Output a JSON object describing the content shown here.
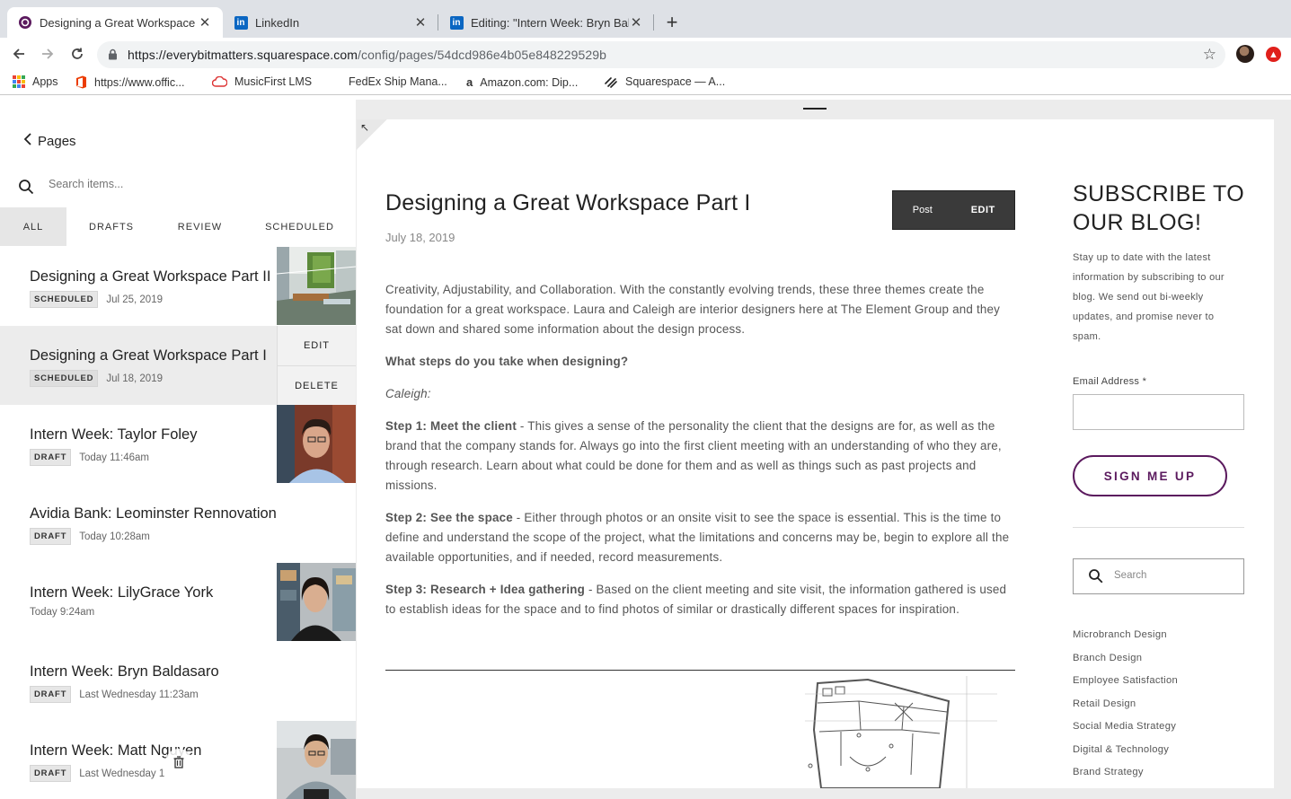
{
  "browser": {
    "tabs": [
      {
        "title": "Designing a Great Workspace P",
        "active": true
      },
      {
        "title": "LinkedIn",
        "active": false
      },
      {
        "title": "Editing: \"Intern Week: Bryn Bal",
        "active": false
      }
    ],
    "url_domain": "https://everybitmatters.squarespace.com",
    "url_path": "/config/pages/54dcd986e4b05e848229529b",
    "bookmarks": [
      "Apps",
      "https://www.offic...",
      "MusicFirst LMS",
      "FedEx Ship Mana...",
      "Amazon.com: Dip...",
      "Squarespace — A..."
    ]
  },
  "panel": {
    "back_label": "Pages",
    "search_placeholder": "Search items...",
    "filters": [
      "ALL",
      "DRAFTS",
      "REVIEW",
      "SCHEDULED"
    ],
    "items": [
      {
        "title": "Designing a Great Workspace Part II",
        "status": "SCHEDULED",
        "date": "Jul 25, 2019"
      },
      {
        "title": "Designing a Great Workspace Part I",
        "status": "SCHEDULED",
        "date": "Jul 18, 2019"
      },
      {
        "title": "Intern Week: Taylor Foley",
        "status": "DRAFT",
        "date": "Today 11:46am"
      },
      {
        "title": "Avidia Bank: Leominster Rennovation",
        "status": "DRAFT",
        "date": "Today 10:28am"
      },
      {
        "title": "Intern Week: LilyGrace York",
        "status": "",
        "date": "Today 9:24am"
      },
      {
        "title": "Intern Week: Bryn Baldasaro",
        "status": "DRAFT",
        "date": "Last Wednesday 11:23am"
      },
      {
        "title": "Intern Week: Matt Nguyen",
        "status": "DRAFT",
        "date": "Last Wednesday 1"
      }
    ],
    "actions": {
      "edit": "EDIT",
      "delete": "DELETE"
    }
  },
  "post": {
    "title": "Designing a Great Workspace Part I",
    "date": "July 18, 2019",
    "btn_post": "Post",
    "btn_edit": "EDIT",
    "intro": "Creativity, Adjustability, and Collaboration. With the constantly evolving trends, these three themes create the foundation for a great workspace. Laura and Caleigh are interior designers here at The Element Group and they sat down and shared some information about the design process.",
    "question": "What steps do you take when designing?",
    "speaker": "Caleigh:",
    "step1_head": "Step 1: Meet the client",
    "step1_body": " - This gives a sense of the personality the client that the designs are for, as well as the brand that the company stands for. Always go into the first client meeting with an understanding of who they are, through research. Learn about what could be done for them and as well as things such as past projects and missions.",
    "step2_head": "Step 2: See the space",
    "step2_body": " - Either through photos or an onsite visit to see the space is essential. This is the time to define and understand the scope of the project, what the limitations and concerns may be, begin to explore all the available opportunities, and if needed, record measurements.",
    "step3_head": "Step 3: Research + Idea gathering",
    "step3_body": " - Based on the client meeting and site visit, the information gathered is used to establish ideas for the space and to find photos of similar or drastically different spaces for inspiration."
  },
  "sidebar": {
    "subscribe_title": "SUBSCRIBE TO OUR BLOG!",
    "subscribe_desc": "Stay up to date with the latest information by subscribing to our blog. We send out bi-weekly updates, and promise never to spam.",
    "email_label": "Email Address *",
    "signup_label": "SIGN ME UP",
    "search_placeholder": "Search",
    "categories": [
      "Microbranch Design",
      "Branch Design",
      "Employee Satisfaction",
      "Retail Design",
      "Social Media Strategy",
      "Digital & Technology",
      "Brand Strategy"
    ]
  },
  "colors": {
    "accent": "#5b1a5e",
    "linkedin": "#0a66c2"
  }
}
